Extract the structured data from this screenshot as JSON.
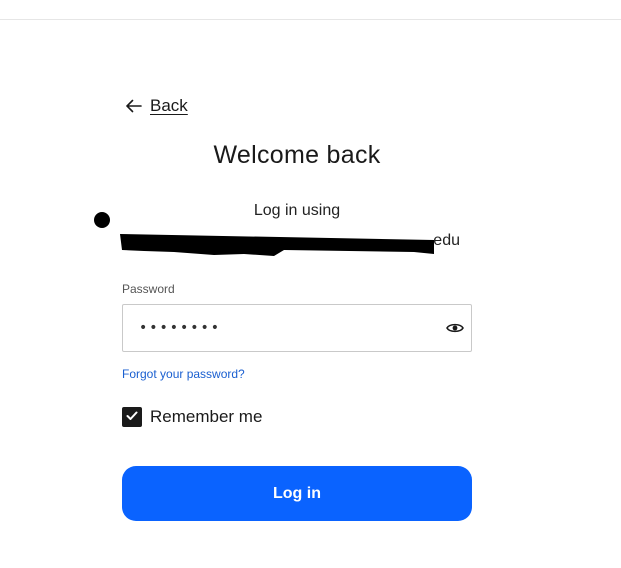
{
  "back": {
    "label": "Back",
    "icon": "arrow-left-icon"
  },
  "title": "Welcome back",
  "login_using": "Log in using",
  "account": {
    "email_visible_suffix": "edu"
  },
  "password": {
    "label": "Password",
    "value": "••••••••",
    "toggle_icon": "eye-icon"
  },
  "forgot_password": "Forgot your password?",
  "remember": {
    "label": "Remember me",
    "checked": true
  },
  "login_button": "Log in",
  "colors": {
    "primary": "#0a63ff",
    "link": "#1a5fd0",
    "checkbox": "#1a1a1a"
  }
}
